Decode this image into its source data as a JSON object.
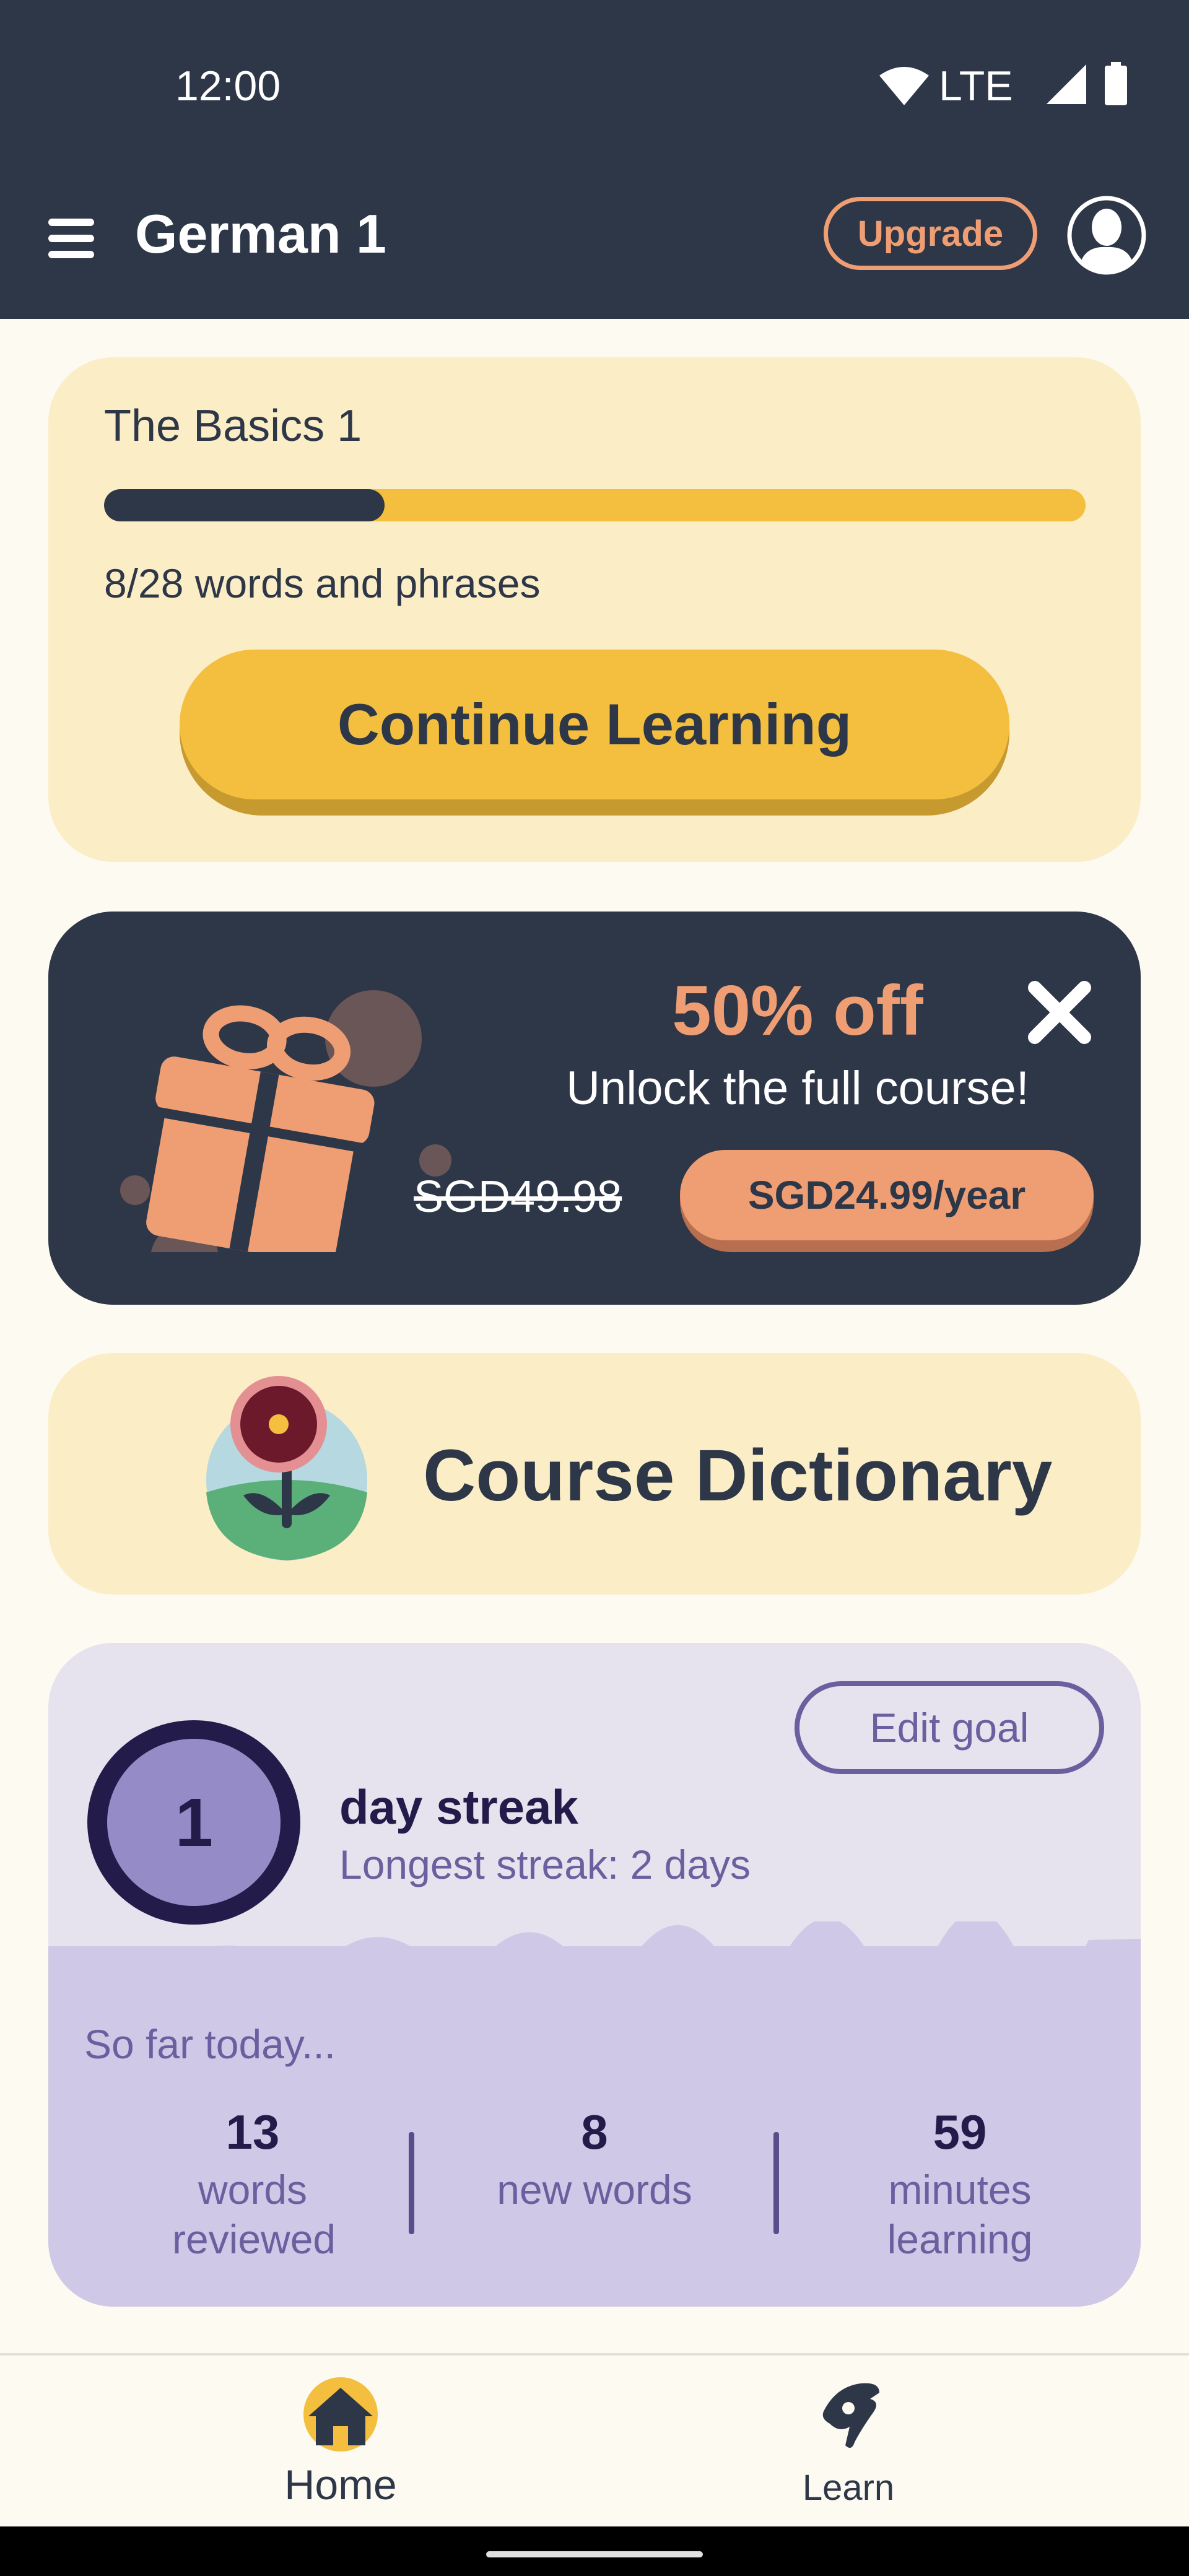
{
  "status_bar": {
    "time": "12:00",
    "network": "LTE"
  },
  "app_bar": {
    "title": "German 1",
    "upgrade_label": "Upgrade"
  },
  "lesson_card": {
    "title": "The Basics 1",
    "progress_text": "8/28 words and phrases",
    "progress_fraction": 0.2857,
    "continue_label": "Continue Learning"
  },
  "promo_card": {
    "title": "50% off",
    "subtitle": "Unlock the full course!",
    "old_price": "SGD49.98",
    "new_price": "SGD24.99/year"
  },
  "dictionary_card": {
    "title": "Course Dictionary"
  },
  "streak_card": {
    "streak_count": "1",
    "streak_label": "day streak",
    "longest_streak": "Longest streak: 2 days",
    "edit_goal_label": "Edit goal",
    "so_far_label": "So far today...",
    "stats": [
      {
        "value": "13",
        "label": "words reviewed"
      },
      {
        "value": "8",
        "label": "new words"
      },
      {
        "value": "59",
        "label": "minutes learning"
      }
    ]
  },
  "bottom_nav": {
    "items": [
      {
        "label": "Home",
        "icon": "home-icon",
        "active": true
      },
      {
        "label": "Learn",
        "icon": "learn-hand-icon",
        "active": false
      }
    ]
  },
  "colors": {
    "dark_navy": "#2e3748",
    "accent_yellow": "#f4bf3f",
    "accent_orange": "#ef9e73",
    "card_cream": "#fbedc6",
    "streak_purple": "#6c5f9f"
  }
}
